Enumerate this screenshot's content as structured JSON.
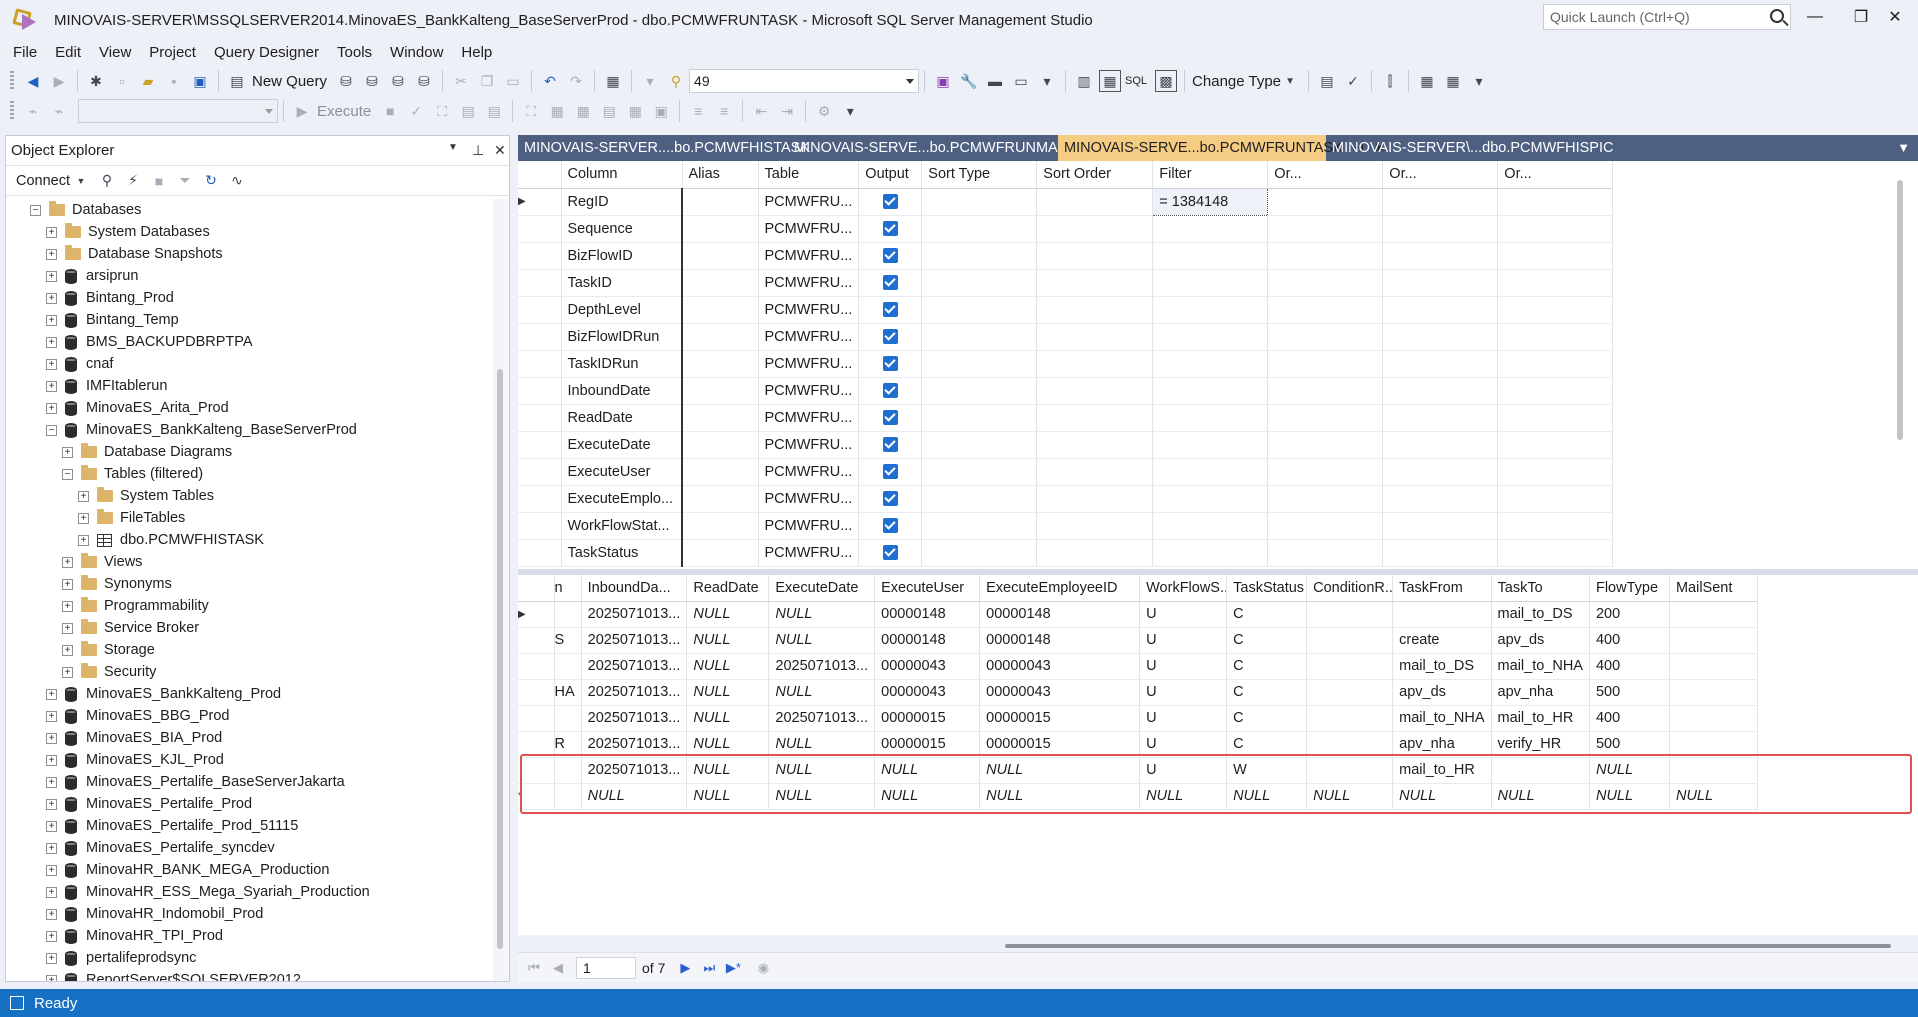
{
  "window": {
    "title": "MINOVAIS-SERVER\\MSSQLSERVER2014.MinovaES_BankKalteng_BaseServerProd - dbo.PCMWFRUNTASK - Microsoft SQL Server Management Studio",
    "quick_launch_placeholder": "Quick Launch (Ctrl+Q)"
  },
  "menu": [
    "File",
    "Edit",
    "View",
    "Project",
    "Query Designer",
    "Tools",
    "Window",
    "Help"
  ],
  "toolbar": {
    "new_query": "New Query",
    "combo_value": "49",
    "sql_label": "SQL",
    "change_type": "Change Type",
    "execute": "Execute"
  },
  "object_explorer": {
    "title": "Object Explorer",
    "connect": "Connect",
    "tree": [
      {
        "label": "Databases",
        "level": 0,
        "exp": "-",
        "icon": "folder"
      },
      {
        "label": "System Databases",
        "level": 1,
        "exp": "+",
        "icon": "folder"
      },
      {
        "label": "Database Snapshots",
        "level": 1,
        "exp": "+",
        "icon": "folder"
      },
      {
        "label": "arsiprun",
        "level": 1,
        "exp": "+",
        "icon": "db"
      },
      {
        "label": "Bintang_Prod",
        "level": 1,
        "exp": "+",
        "icon": "db"
      },
      {
        "label": "Bintang_Temp",
        "level": 1,
        "exp": "+",
        "icon": "db"
      },
      {
        "label": "BMS_BACKUPDBRPTPA",
        "level": 1,
        "exp": "+",
        "icon": "db"
      },
      {
        "label": "cnaf",
        "level": 1,
        "exp": "+",
        "icon": "db"
      },
      {
        "label": "IMFItablerun",
        "level": 1,
        "exp": "+",
        "icon": "db"
      },
      {
        "label": "MinovaES_Arita_Prod",
        "level": 1,
        "exp": "+",
        "icon": "db"
      },
      {
        "label": "MinovaES_BankKalteng_BaseServerProd",
        "level": 1,
        "exp": "-",
        "icon": "db"
      },
      {
        "label": "Database Diagrams",
        "level": 2,
        "exp": "+",
        "icon": "folder"
      },
      {
        "label": "Tables (filtered)",
        "level": 2,
        "exp": "-",
        "icon": "folder"
      },
      {
        "label": "System Tables",
        "level": 3,
        "exp": "+",
        "icon": "folder"
      },
      {
        "label": "FileTables",
        "level": 3,
        "exp": "+",
        "icon": "folder"
      },
      {
        "label": "dbo.PCMWFHISTASK",
        "level": 3,
        "exp": "+",
        "icon": "table"
      },
      {
        "label": "Views",
        "level": 2,
        "exp": "+",
        "icon": "folder"
      },
      {
        "label": "Synonyms",
        "level": 2,
        "exp": "+",
        "icon": "folder"
      },
      {
        "label": "Programmability",
        "level": 2,
        "exp": "+",
        "icon": "folder"
      },
      {
        "label": "Service Broker",
        "level": 2,
        "exp": "+",
        "icon": "folder"
      },
      {
        "label": "Storage",
        "level": 2,
        "exp": "+",
        "icon": "folder"
      },
      {
        "label": "Security",
        "level": 2,
        "exp": "+",
        "icon": "folder"
      },
      {
        "label": "MinovaES_BankKalteng_Prod",
        "level": 1,
        "exp": "+",
        "icon": "db"
      },
      {
        "label": "MinovaES_BBG_Prod",
        "level": 1,
        "exp": "+",
        "icon": "db"
      },
      {
        "label": "MinovaES_BIA_Prod",
        "level": 1,
        "exp": "+",
        "icon": "db"
      },
      {
        "label": "MinovaES_KJL_Prod",
        "level": 1,
        "exp": "+",
        "icon": "db"
      },
      {
        "label": "MinovaES_Pertalife_BaseServerJakarta",
        "level": 1,
        "exp": "+",
        "icon": "db"
      },
      {
        "label": "MinovaES_Pertalife_Prod",
        "level": 1,
        "exp": "+",
        "icon": "db"
      },
      {
        "label": "MinovaES_Pertalife_Prod_51115",
        "level": 1,
        "exp": "+",
        "icon": "db"
      },
      {
        "label": "MinovaES_Pertalife_syncdev",
        "level": 1,
        "exp": "+",
        "icon": "db"
      },
      {
        "label": "MinovaHR_BANK_MEGA_Production",
        "level": 1,
        "exp": "+",
        "icon": "db"
      },
      {
        "label": "MinovaHR_ESS_Mega_Syariah_Production",
        "level": 1,
        "exp": "+",
        "icon": "db"
      },
      {
        "label": "MinovaHR_Indomobil_Prod",
        "level": 1,
        "exp": "+",
        "icon": "db"
      },
      {
        "label": "MinovaHR_TPI_Prod",
        "level": 1,
        "exp": "+",
        "icon": "db"
      },
      {
        "label": "pertalifeprodsync",
        "level": 1,
        "exp": "+",
        "icon": "db"
      },
      {
        "label": "ReportServer$SQLSERVER2012",
        "level": 1,
        "exp": "+",
        "icon": "db"
      }
    ]
  },
  "tabs": [
    {
      "label": "MINOVAIS-SERVER....bo.PCMWFHISTASK",
      "active": false
    },
    {
      "label": "MINOVAIS-SERVE...bo.PCMWFRUNMAIN",
      "active": false
    },
    {
      "label": "MINOVAIS-SERVE...bo.PCMWFRUNTASK",
      "active": true
    },
    {
      "label": "MINOVAIS-SERVER\\...dbo.PCMWFHISPIC",
      "active": false
    }
  ],
  "criteria": {
    "headers": [
      "Column",
      "Alias",
      "Table",
      "Output",
      "Sort Type",
      "Sort Order",
      "Filter",
      "Or...",
      "Or...",
      "Or..."
    ],
    "rows": [
      {
        "column": "RegID",
        "table": "PCMWFRU...",
        "filter": "= 1384148"
      },
      {
        "column": "Sequence",
        "table": "PCMWFRU...",
        "filter": ""
      },
      {
        "column": "BizFlowID",
        "table": "PCMWFRU...",
        "filter": ""
      },
      {
        "column": "TaskID",
        "table": "PCMWFRU...",
        "filter": ""
      },
      {
        "column": "DepthLevel",
        "table": "PCMWFRU...",
        "filter": ""
      },
      {
        "column": "BizFlowIDRun",
        "table": "PCMWFRU...",
        "filter": ""
      },
      {
        "column": "TaskIDRun",
        "table": "PCMWFRU...",
        "filter": ""
      },
      {
        "column": "InboundDate",
        "table": "PCMWFRU...",
        "filter": ""
      },
      {
        "column": "ReadDate",
        "table": "PCMWFRU...",
        "filter": ""
      },
      {
        "column": "ExecuteDate",
        "table": "PCMWFRU...",
        "filter": ""
      },
      {
        "column": "ExecuteUser",
        "table": "PCMWFRU...",
        "filter": ""
      },
      {
        "column": "ExecuteEmplo...",
        "table": "PCMWFRU...",
        "filter": ""
      },
      {
        "column": "WorkFlowStat...",
        "table": "PCMWFRU...",
        "filter": ""
      },
      {
        "column": "TaskStatus",
        "table": "PCMWFRU...",
        "filter": ""
      }
    ]
  },
  "results": {
    "headers": [
      "n",
      "InboundDa...",
      "ReadDate",
      "ExecuteDate",
      "ExecuteUser",
      "ExecuteEmployeeID",
      "WorkFlowS...",
      "TaskStatus",
      "ConditionR...",
      "TaskFrom",
      "TaskTo",
      "FlowType",
      "MailSent"
    ],
    "rows": [
      {
        "marker": "▶",
        "cells": [
          "",
          "2025071013...",
          "NULL",
          "NULL",
          "00000148",
          "00000148",
          "U",
          "C",
          "",
          "",
          "mail_to_DS",
          "200",
          ""
        ]
      },
      {
        "marker": "",
        "cells": [
          "S",
          "2025071013...",
          "NULL",
          "NULL",
          "00000148",
          "00000148",
          "U",
          "C",
          "",
          "create",
          "apv_ds",
          "400",
          ""
        ]
      },
      {
        "marker": "",
        "cells": [
          "",
          "2025071013...",
          "NULL",
          "2025071013...",
          "00000043",
          "00000043",
          "U",
          "C",
          "",
          "mail_to_DS",
          "mail_to_NHA",
          "400",
          ""
        ]
      },
      {
        "marker": "",
        "cells": [
          "HA",
          "2025071013...",
          "NULL",
          "NULL",
          "00000043",
          "00000043",
          "U",
          "C",
          "",
          "apv_ds",
          "apv_nha",
          "500",
          ""
        ]
      },
      {
        "marker": "",
        "cells": [
          "",
          "2025071013...",
          "NULL",
          "2025071013...",
          "00000015",
          "00000015",
          "U",
          "C",
          "",
          "mail_to_NHA",
          "mail_to_HR",
          "400",
          ""
        ]
      },
      {
        "marker": "",
        "cells": [
          "R",
          "2025071013...",
          "NULL",
          "NULL",
          "00000015",
          "00000015",
          "U",
          "C",
          "",
          "apv_nha",
          "verify_HR",
          "500",
          ""
        ]
      },
      {
        "marker": "",
        "cells": [
          "",
          "2025071013...",
          "NULL",
          "NULL",
          "NULL",
          "NULL",
          "U",
          "W",
          "",
          "mail_to_HR",
          "",
          "NULL",
          ""
        ]
      },
      {
        "marker": "*",
        "cells": [
          "",
          "NULL",
          "NULL",
          "NULL",
          "NULL",
          "NULL",
          "NULL",
          "NULL",
          "NULL",
          "NULL",
          "NULL",
          "NULL",
          "NULL"
        ]
      }
    ]
  },
  "navigation": {
    "current_page": "1",
    "total": "of 7"
  },
  "status": {
    "text": "Ready"
  }
}
